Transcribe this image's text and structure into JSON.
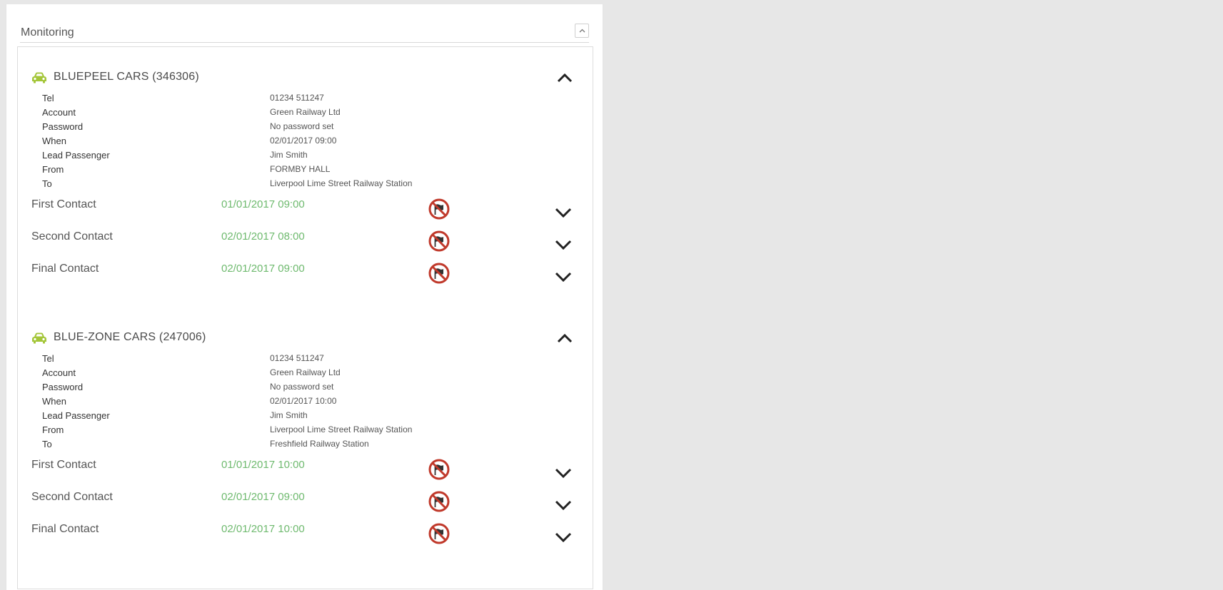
{
  "panel": {
    "title": "Monitoring"
  },
  "colors": {
    "car_icon": "#a4c639",
    "contact_time": "#6fba6f",
    "no_flag_ring": "#c0392b"
  },
  "bookings": [
    {
      "title": "BLUEPEEL CARS (346306)",
      "details": [
        {
          "label": "Tel",
          "value": "01234 511247"
        },
        {
          "label": "Account",
          "value": "Green Railway Ltd"
        },
        {
          "label": "Password",
          "value": "No password set"
        },
        {
          "label": "When",
          "value": "02/01/2017 09:00"
        },
        {
          "label": "Lead Passenger",
          "value": "Jim Smith"
        },
        {
          "label": "From",
          "value": "FORMBY HALL"
        },
        {
          "label": "To",
          "value": "Liverpool Lime Street Railway Station"
        }
      ],
      "contacts": [
        {
          "label": "First Contact",
          "time": "01/01/2017 09:00"
        },
        {
          "label": "Second Contact",
          "time": "02/01/2017 08:00"
        },
        {
          "label": "Final Contact",
          "time": "02/01/2017 09:00"
        }
      ]
    },
    {
      "title": "BLUE-ZONE CARS (247006)",
      "details": [
        {
          "label": "Tel",
          "value": "01234 511247"
        },
        {
          "label": "Account",
          "value": "Green Railway Ltd"
        },
        {
          "label": "Password",
          "value": "No password set"
        },
        {
          "label": "When",
          "value": "02/01/2017 10:00"
        },
        {
          "label": "Lead Passenger",
          "value": "Jim Smith"
        },
        {
          "label": "From",
          "value": "Liverpool Lime Street Railway Station"
        },
        {
          "label": "To",
          "value": "Freshfield Railway Station"
        }
      ],
      "contacts": [
        {
          "label": "First Contact",
          "time": "01/01/2017 10:00"
        },
        {
          "label": "Second Contact",
          "time": "02/01/2017 09:00"
        },
        {
          "label": "Final Contact",
          "time": "02/01/2017 10:00"
        }
      ]
    }
  ]
}
